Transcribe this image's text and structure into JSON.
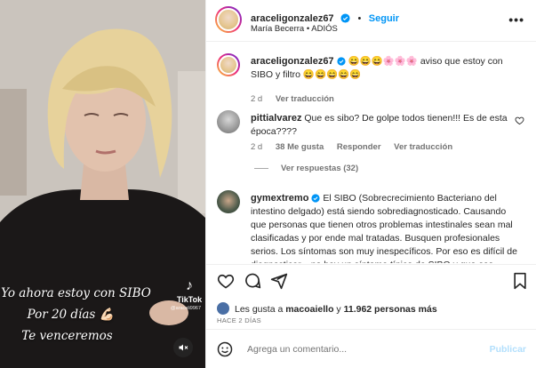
{
  "post": {
    "username": "araceligonzalez67",
    "follow_label": "Seguir",
    "audio": "María Becerra • ADIÓS",
    "more_label": "•••"
  },
  "video": {
    "caption_line1": "Yo ahora estoy con SIBO",
    "caption_line2": "Por 20 días 💪🏻",
    "caption_line3": "Te venceremos",
    "tiktok_label": "TikTok",
    "tiktok_user": "@araceli9967"
  },
  "comments": [
    {
      "username": "araceligonzalez67",
      "text": " 😄😄😄🌸🌸🌸 aviso que estoy con SIBO y filtro 😄😄😄😄😄",
      "time": "2 d",
      "translate": "Ver traducción"
    },
    {
      "username": "pittialvarez",
      "text": " Que es sibo? De golpe todos tienen!!! Es de esta época????",
      "time": "2 d",
      "likes": "38 Me gusta",
      "reply": "Responder",
      "translate": "Ver traducción",
      "view_replies": "Ver respuestas (32)"
    },
    {
      "username": "gymextremo",
      "text": " El SIBO (Sobrecrecimiento Bacteriano del intestino delgado) está siendo sobrediagnosticado. Causando que personas que tienen otros problemas intestinales sean mal clasificadas y por ende mal tratadas. Busquen profesionales serios. Los síntomas son muy inespecíficos. Por eso es difícil de diagnosticar... no hay un síntoma típico de SIBO y que ese"
    }
  ],
  "actions": {
    "likes_prefix": "Les gusta a ",
    "likes_user": "macoaiello",
    "likes_middle": " y ",
    "likes_count": "11.962 personas más",
    "date": "HACE 2 DÍAS"
  },
  "composer": {
    "placeholder": "Agrega un comentario...",
    "publish_label": "Publicar"
  },
  "colors": {
    "accent": "#0095f6",
    "verified": "#0095f6",
    "muted_text": "#737373"
  }
}
